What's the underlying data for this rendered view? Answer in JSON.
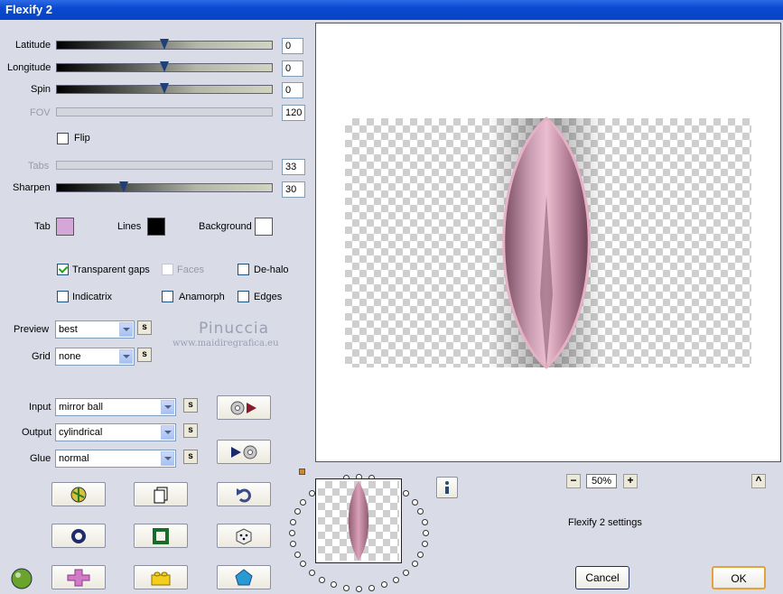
{
  "window": {
    "title": "Flexify 2"
  },
  "sliders": {
    "latitude": {
      "label": "Latitude",
      "value": "0",
      "position": 0.5
    },
    "longitude": {
      "label": "Longitude",
      "value": "0",
      "position": 0.5
    },
    "spin": {
      "label": "Spin",
      "value": "0",
      "position": 0.5
    },
    "fov": {
      "label": "FOV",
      "value": "120"
    },
    "tabs": {
      "label": "Tabs",
      "value": "33"
    },
    "sharpen": {
      "label": "Sharpen",
      "value": "30",
      "position": 0.3
    }
  },
  "flip": {
    "label": "Flip",
    "checked": false
  },
  "colors": {
    "tab": {
      "label": "Tab",
      "color": "#d4a7d8"
    },
    "lines": {
      "label": "Lines",
      "color": "#000000"
    },
    "background": {
      "label": "Background",
      "color": "#ffffff"
    }
  },
  "options": {
    "transparent_gaps": {
      "label": "Transparent gaps",
      "checked": true
    },
    "faces": {
      "label": "Faces",
      "checked": false
    },
    "de_halo": {
      "label": "De-halo",
      "checked": false
    },
    "indicatrix": {
      "label": "Indicatrix",
      "checked": false
    },
    "anamorph": {
      "label": "Anamorph",
      "checked": false
    },
    "edges": {
      "label": "Edges",
      "checked": false
    }
  },
  "dropdowns": {
    "preview": {
      "label": "Preview",
      "value": "best"
    },
    "grid": {
      "label": "Grid",
      "value": "none"
    },
    "input": {
      "label": "Input",
      "value": "mirror ball"
    },
    "output": {
      "label": "Output",
      "value": "cylindrical"
    },
    "glue": {
      "label": "Glue",
      "value": "normal"
    }
  },
  "small_button_label": "s",
  "watermark": {
    "name": "Pinuccia",
    "url": "www.maidiregrafica.eu"
  },
  "zoom": {
    "value": "50%",
    "minus": "−",
    "plus": "+"
  },
  "settings_text": "Flexify 2 settings",
  "buttons": {
    "cancel": "Cancel",
    "ok": "OK",
    "collapse": "^",
    "info": "i"
  },
  "icons": [
    "globe-icon",
    "copy-page-icon",
    "undo-icon",
    "ring-icon",
    "square-icon",
    "dice-icon",
    "mirror-ball-icon",
    "plus-shape-icon",
    "lego-brick-icon",
    "pentagon-icon",
    "record-play-icon",
    "play-record-icon",
    "info-icon"
  ],
  "accent_colors": {
    "titlebar": "#0a4ad0",
    "preview_object": "#b07f92",
    "ok_border": "#e3a33a"
  }
}
